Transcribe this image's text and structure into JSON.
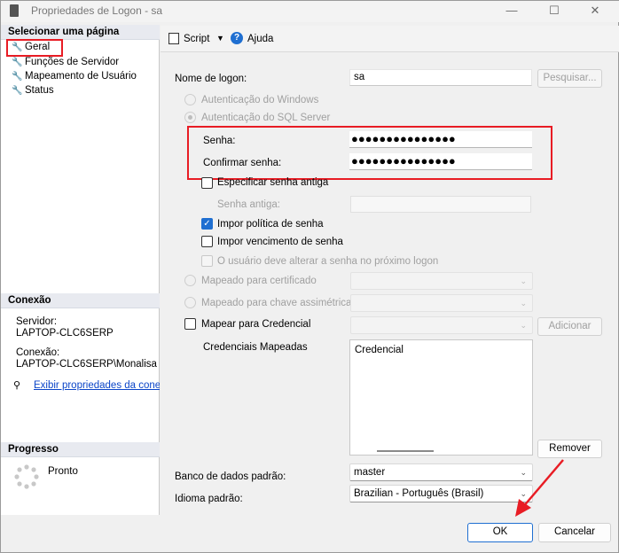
{
  "window": {
    "title": "Propriedades de Logon - sa",
    "minimize": "—",
    "maximize": "☐",
    "close": "✕"
  },
  "left": {
    "select_page_header": "Selecionar uma página",
    "pages": [
      {
        "label": "Geral",
        "icon": "wrench-icon"
      },
      {
        "label": "Funções de Servidor",
        "icon": "wrench-icon"
      },
      {
        "label": "Mapeamento de Usuário",
        "icon": "wrench-icon"
      },
      {
        "label": "Status",
        "icon": "wrench-icon"
      }
    ],
    "connection_header": "Conexão",
    "server_label": "Servidor:",
    "server_value": "LAPTOP-CLC6SERP",
    "connection_label": "Conexão:",
    "connection_value": "LAPTOP-CLC6SERP\\Monalisa",
    "view_props_link": "Exibir propriedades da conexã",
    "progress_header": "Progresso",
    "progress_status": "Pronto"
  },
  "toolbar": {
    "script_label": "Script",
    "help_label": "Ajuda"
  },
  "form": {
    "login_name_label": "Nome de logon:",
    "login_name_value": "sa",
    "search_button": "Pesquisar...",
    "windows_auth": "Autenticação do Windows",
    "sql_auth": "Autenticação do SQL Server",
    "password_label": "Senha:",
    "password_value": "●●●●●●●●●●●●●●●",
    "confirm_password_label": "Confirmar senha:",
    "confirm_password_value": "●●●●●●●●●●●●●●●",
    "specify_old_password": "Especificar senha antiga",
    "old_password_label": "Senha antiga:",
    "enforce_policy": "Impor política de senha",
    "enforce_expiration": "Impor vencimento de senha",
    "must_change": "O usuário deve alterar a senha no próximo logon",
    "map_certificate": "Mapeado para certificado",
    "map_asymmetric_key": "Mapeado para chave assimétrica",
    "map_credential": "Mapear para Credencial",
    "add_button": "Adicionar",
    "mapped_credentials_label": "Credenciais Mapeadas",
    "credential_column": "Credencial",
    "remove_button": "Remover",
    "default_db_label": "Banco de dados padrão:",
    "default_db_value": "master",
    "default_lang_label": "Idioma padrão:",
    "default_lang_value": "Brazilian - Português (Brasil)"
  },
  "footer": {
    "ok_label": "OK",
    "cancel_label": "Cancelar"
  },
  "colors": {
    "highlight_red": "#e81c24",
    "link_blue": "#0b45c8",
    "check_blue": "#1f6fd1"
  }
}
